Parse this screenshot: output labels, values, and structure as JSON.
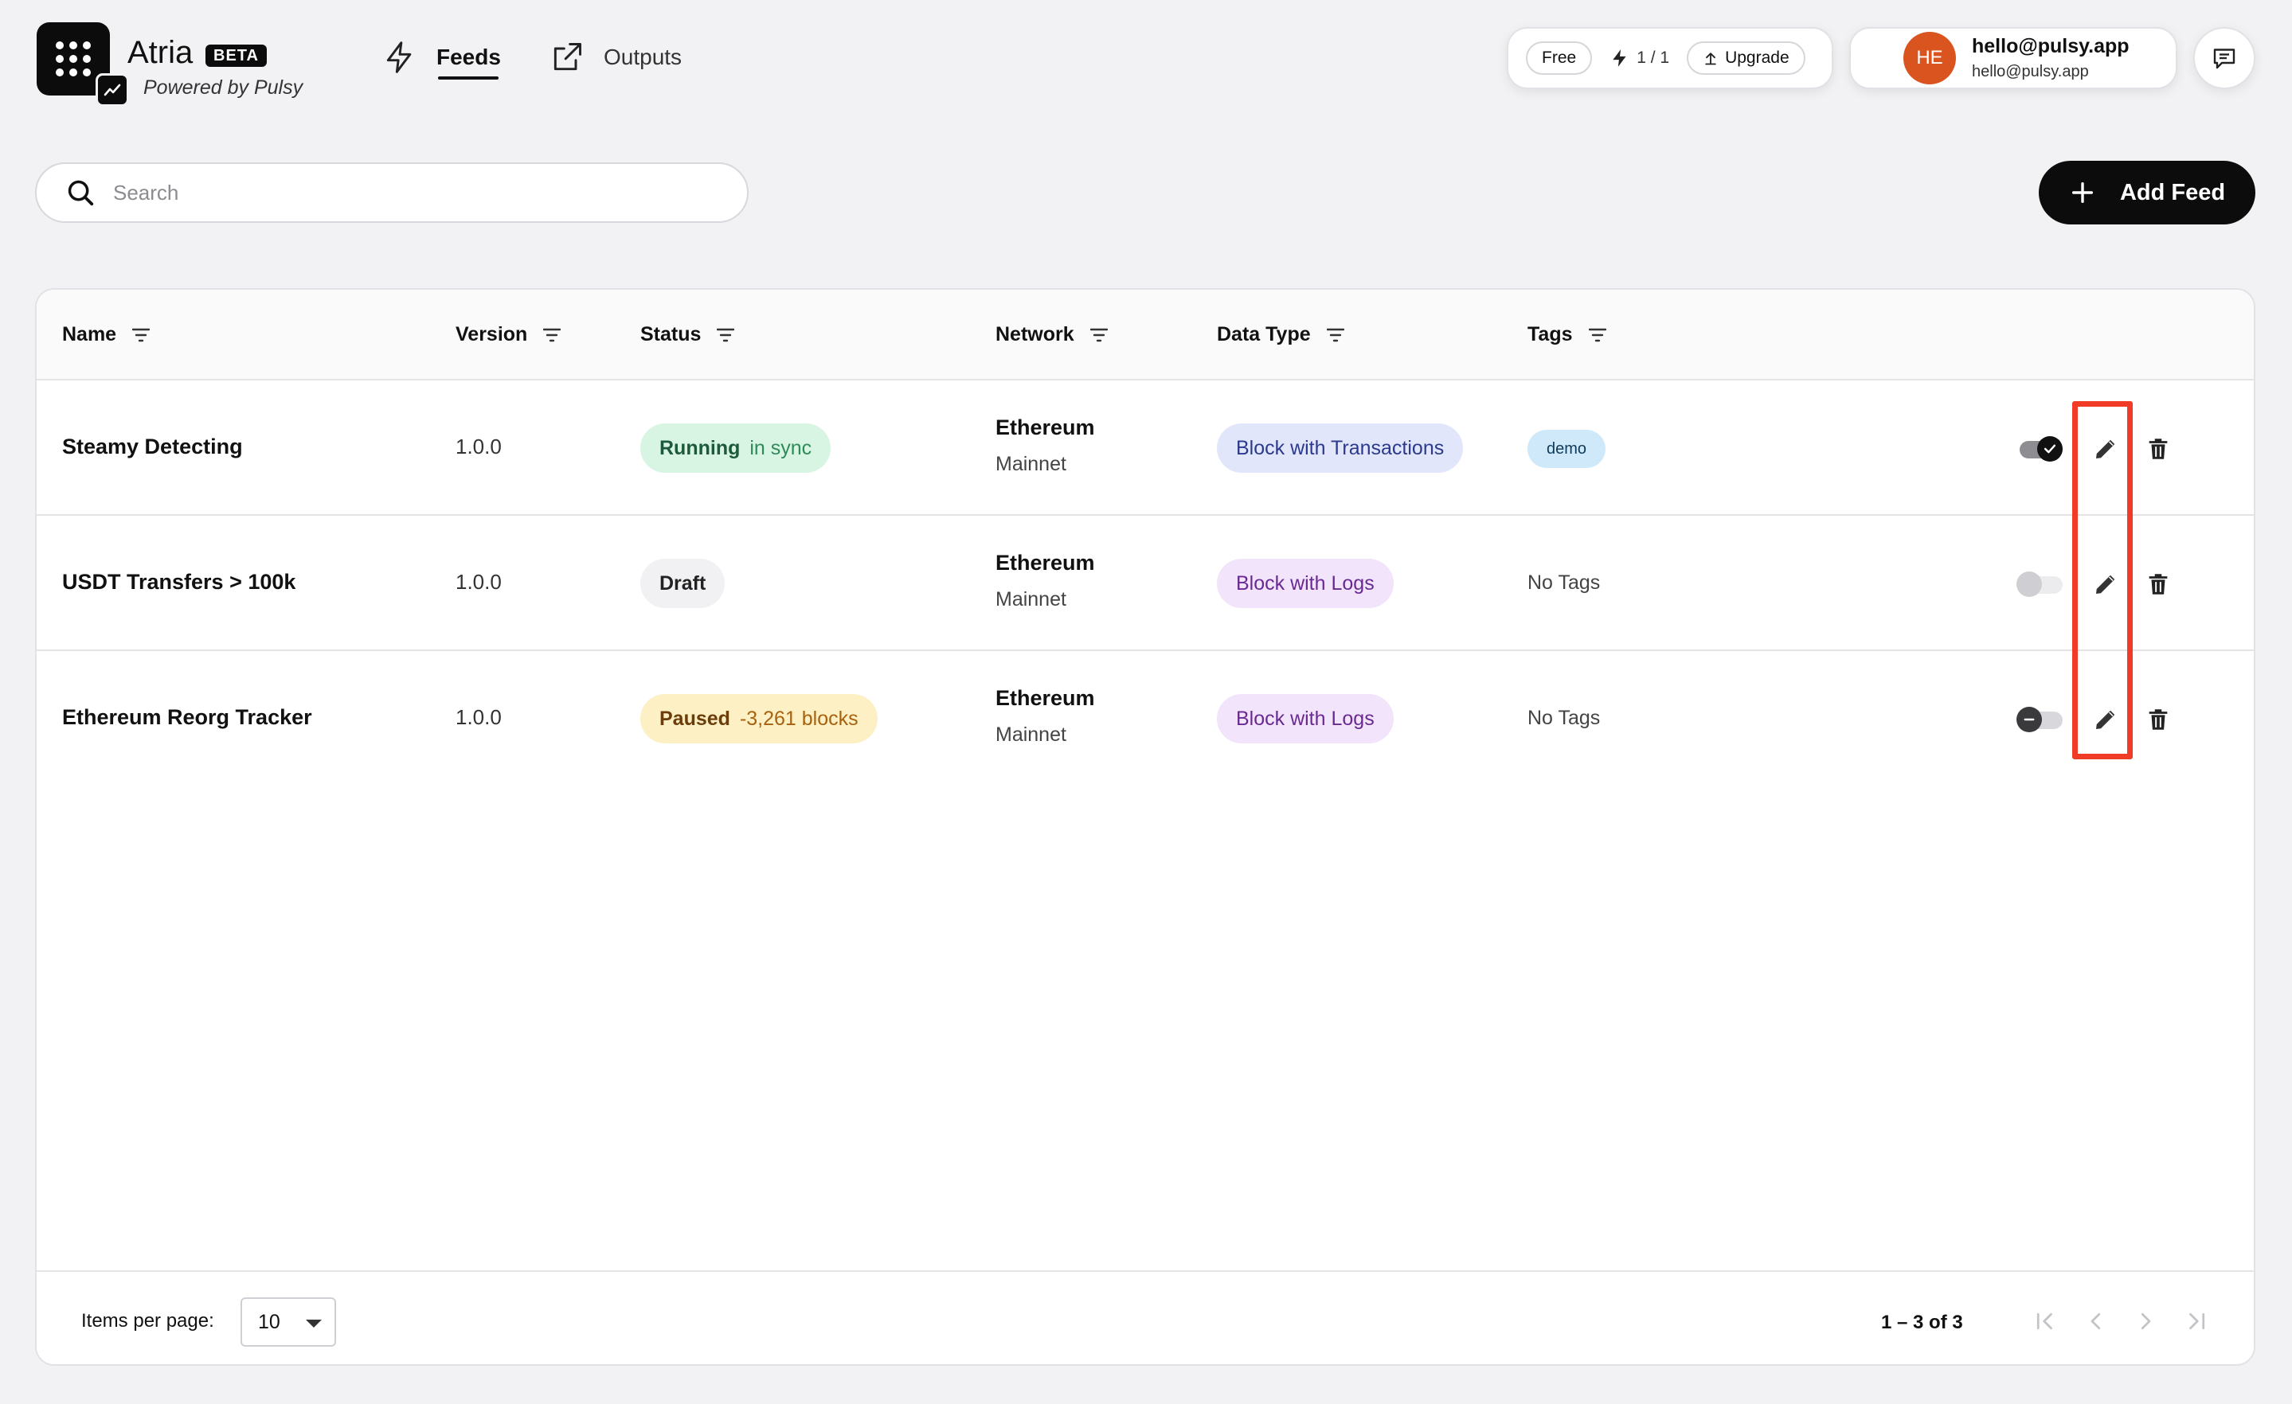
{
  "app": {
    "name": "Atria",
    "badge": "BETA",
    "powered_by": "Powered by Pulsy"
  },
  "nav": {
    "tabs": [
      {
        "label": "Feeds",
        "icon": "bolt-icon",
        "active": true
      },
      {
        "label": "Outputs",
        "icon": "external-link-icon",
        "active": false
      }
    ]
  },
  "plan": {
    "tier": "Free",
    "usage": "1 / 1",
    "upgrade_label": "Upgrade"
  },
  "user": {
    "initials": "HE",
    "email_primary": "hello@pulsy.app",
    "email_secondary": "hello@pulsy.app",
    "avatar_color": "#d9541f"
  },
  "search": {
    "placeholder": "Search",
    "value": ""
  },
  "add_feed_label": "Add Feed",
  "table": {
    "columns": [
      "Name",
      "Version",
      "Status",
      "Network",
      "Data Type",
      "Tags"
    ],
    "rows": [
      {
        "name": "Steamy Detecting",
        "version": "1.0.0",
        "status": "Running",
        "status_detail": "in sync",
        "network": "Ethereum",
        "network_sub": "Mainnet",
        "data_type": "Block with Transactions",
        "tags": [
          "demo"
        ],
        "enabled": "on"
      },
      {
        "name": "USDT Transfers > 100k",
        "version": "1.0.0",
        "status": "Draft",
        "status_detail": "",
        "network": "Ethereum",
        "network_sub": "Mainnet",
        "data_type": "Block with Logs",
        "tags_text": "No Tags",
        "enabled": "disabled"
      },
      {
        "name": "Ethereum Reorg Tracker",
        "version": "1.0.0",
        "status": "Paused",
        "status_detail": "-3,261 blocks",
        "network": "Ethereum",
        "network_sub": "Mainnet",
        "data_type": "Block with Logs",
        "tags_text": "No Tags",
        "enabled": "off"
      }
    ]
  },
  "pagination": {
    "items_per_page_label": "Items per page:",
    "items_per_page": "10",
    "range": "1 – 3 of 3"
  },
  "colors": {
    "accent": "#0c0c0c",
    "highlight": "#f03c27",
    "running_bg": "#d8f5e4",
    "paused_bg": "#fdf0c4",
    "draft_bg": "#f1f1f3",
    "tx_type_bg": "#e2e6fb",
    "logs_type_bg": "#f1e4fb"
  }
}
